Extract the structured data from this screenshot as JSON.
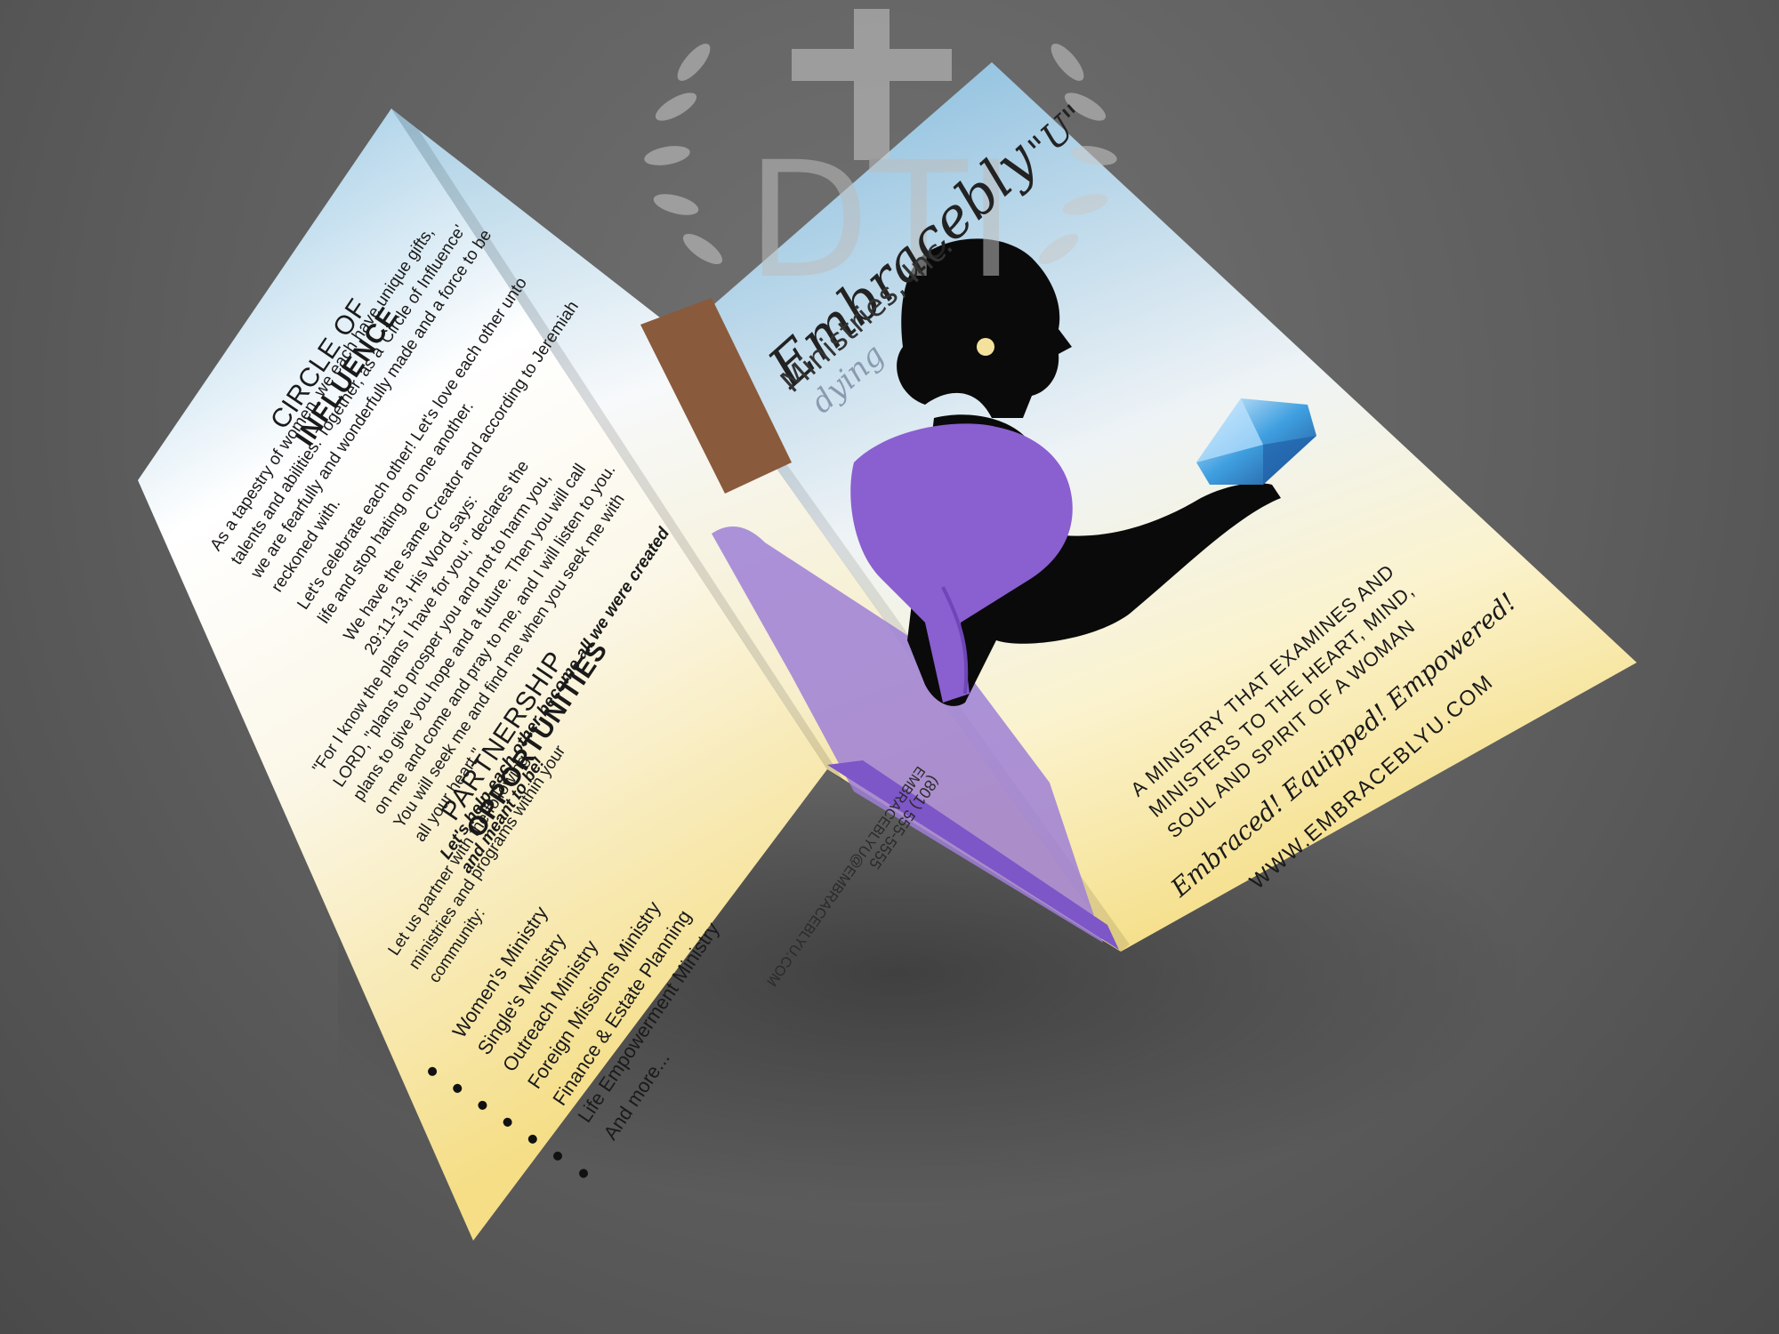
{
  "watermark": {
    "monogram": "DTI"
  },
  "panel_left": {
    "heading_light": "CIRCLE OF",
    "heading_bold": "INFLUENCE",
    "paragraph_1": "As a tapestry of women, we each have unique gifts, talents and abilities. Together, as a 'Circle of Influence' we are fearfully and wonderfully made and a force to be reckoned with.",
    "paragraph_2": "Let's celebrate each other! Let's love each other unto life and stop hating on one another.",
    "paragraph_3": "We have the same Creator and according to Jeremiah 29:11-13, His Word says:",
    "paragraph_4": "\"For I know the plans I have for you,\" declares the LORD, \"plans to prosper you and not to harm you, plans to give you hope and a future. Then you will call on me and come and pray to me, and I will listen to you. You will seek me and find me when you seek me with all your heart.\"",
    "emphasis": "Let's help each other become all we were created and meant to be!",
    "section2_light": "PARTNERSHIP",
    "section2_bold": "OPPORTUNITIES",
    "section2_intro": "Let us partner with the following ministries and programs within your community:",
    "ministries": [
      "Women's Ministry",
      "Single's Ministry",
      "Outreach Ministry",
      "Foreign Missions Ministry",
      "Finance & Estate Planning",
      "Life Empowerment Ministry",
      "And more..."
    ]
  },
  "panel_middle": {
    "phone": "(801) 555-5555",
    "email": "EMBRACEBLYU@EMBRACEBLYU.COM"
  },
  "panel_cover": {
    "brand_script": "Embracebly",
    "brand_u": "\"U\"",
    "brand_sub": "Ministries, Inc.",
    "brand_tagline": "dying",
    "mission": "A MINISTRY THAT EXAMINES AND MINISTERS TO THE HEART, MIND, SOUL AND SPIRIT OF A WOMAN",
    "motto": "Embraced! Equipped! Empowered!",
    "website": "WWW.EMBRACEBLYU.COM"
  },
  "colors": {
    "background": "#5f5f5f",
    "sky_blue": "#8fbfdf",
    "pale_yellow": "#f6e58f",
    "purple": "#8a5fd0",
    "silhouette": "#0a0a0a",
    "gem": "#3fa0e0"
  }
}
